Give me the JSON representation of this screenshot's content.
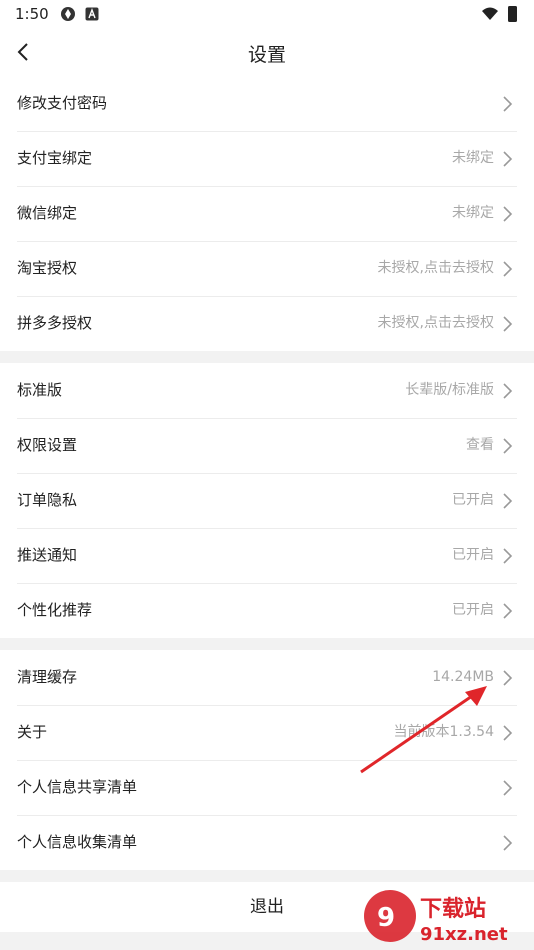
{
  "status_bar": {
    "time": "1:50",
    "icons": [
      "aperture-icon",
      "a-badge-icon",
      "wifi-icon",
      "battery-icon"
    ]
  },
  "nav": {
    "title": "设置",
    "back_icon": "chevron-left-icon"
  },
  "groups": [
    [
      {
        "label": "修改支付密码",
        "value": ""
      },
      {
        "label": "支付宝绑定",
        "value": "未绑定"
      },
      {
        "label": "微信绑定",
        "value": "未绑定"
      },
      {
        "label": "淘宝授权",
        "value": "未授权,点击去授权"
      },
      {
        "label": "拼多多授权",
        "value": "未授权,点击去授权"
      }
    ],
    [
      {
        "label": "标准版",
        "value": "长辈版/标准版"
      },
      {
        "label": "权限设置",
        "value": "查看"
      },
      {
        "label": "订单隐私",
        "value": "已开启"
      },
      {
        "label": "推送通知",
        "value": "已开启"
      },
      {
        "label": "个性化推荐",
        "value": "已开启"
      }
    ],
    [
      {
        "label": "清理缓存",
        "value": "14.24MB"
      },
      {
        "label": "关于",
        "value": "当前版本1.3.54"
      },
      {
        "label": "个人信息共享清单",
        "value": ""
      },
      {
        "label": "个人信息收集清单",
        "value": ""
      }
    ]
  ],
  "logout_label": "退出",
  "watermark": {
    "text_top": "下载站",
    "text_bottom": "91xz.net"
  },
  "colors": {
    "background": "#f2f2f2",
    "annotation_arrow": "#e0262a",
    "watermark_red": "#d9232c"
  }
}
